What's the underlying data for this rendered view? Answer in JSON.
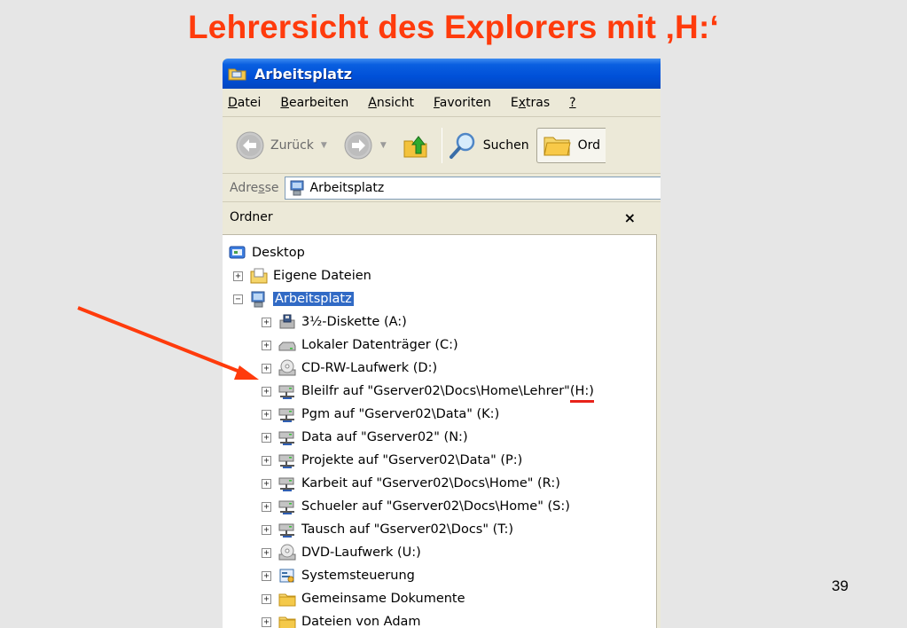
{
  "slide": {
    "title": "Lehrersicht des Explorers mit ‚H:‘",
    "page_number": "39"
  },
  "window": {
    "title": "Arbeitsplatz",
    "menu": [
      {
        "label": "Datei"
      },
      {
        "label": "Bearbeiten"
      },
      {
        "label": "Ansicht"
      },
      {
        "label": "Favoriten"
      },
      {
        "label": "Extras"
      },
      {
        "label": "?"
      }
    ],
    "toolbar": {
      "back_label": "Zurück",
      "search_label": "Suchen",
      "folders_label": "Ord"
    },
    "address": {
      "label": "Adresse",
      "value": "Arbeitsplatz"
    },
    "folder_pane": {
      "title": "Ordner",
      "close": "×"
    },
    "tree": [
      {
        "label": "Desktop",
        "icon": "desktop-icon",
        "expander": ""
      },
      {
        "label": "Eigene Dateien",
        "icon": "documents-folder-icon",
        "expander": "+"
      },
      {
        "label": "Arbeitsplatz",
        "icon": "computer-icon",
        "expander": "−",
        "selected": true
      },
      {
        "label": "3½-Diskette (A:)",
        "icon": "floppy-drive-icon",
        "expander": "+"
      },
      {
        "label": "Lokaler Datenträger (C:)",
        "icon": "hard-drive-icon",
        "expander": "+"
      },
      {
        "label": "CD-RW-Laufwerk (D:)",
        "icon": "cd-drive-icon",
        "expander": "+"
      },
      {
        "label": "Bleilfr auf \"Gserver02\\Docs\\Home\\Lehrer\" ",
        "label_mark": "(H:)",
        "icon": "network-drive-icon",
        "expander": "+"
      },
      {
        "label": "Pgm auf \"Gserver02\\Data\" (K:)",
        "icon": "network-drive-icon",
        "expander": "+"
      },
      {
        "label": "Data auf \"Gserver02\" (N:)",
        "icon": "network-drive-icon",
        "expander": "+"
      },
      {
        "label": "Projekte auf \"Gserver02\\Data\" (P:)",
        "icon": "network-drive-icon",
        "expander": "+"
      },
      {
        "label": "Karbeit auf \"Gserver02\\Docs\\Home\" (R:)",
        "icon": "network-drive-icon",
        "expander": "+"
      },
      {
        "label": "Schueler auf \"Gserver02\\Docs\\Home\" (S:)",
        "icon": "network-drive-icon",
        "expander": "+"
      },
      {
        "label": "Tausch auf \"Gserver02\\Docs\" (T:)",
        "icon": "network-drive-icon",
        "expander": "+"
      },
      {
        "label": "DVD-Laufwerk (U:)",
        "icon": "cd-drive-icon",
        "expander": "+"
      },
      {
        "label": "Systemsteuerung",
        "icon": "control-panel-icon",
        "expander": "+"
      },
      {
        "label": "Gemeinsame Dokumente",
        "icon": "folder-icon",
        "expander": "+"
      },
      {
        "label": "Dateien von Adam",
        "icon": "folder-icon",
        "expander": "+"
      }
    ]
  },
  "colors": {
    "title_red": "#ff3b0c",
    "xp_blue": "#0050d8",
    "selection": "#316ac5",
    "annotation_red": "#e8231a"
  }
}
